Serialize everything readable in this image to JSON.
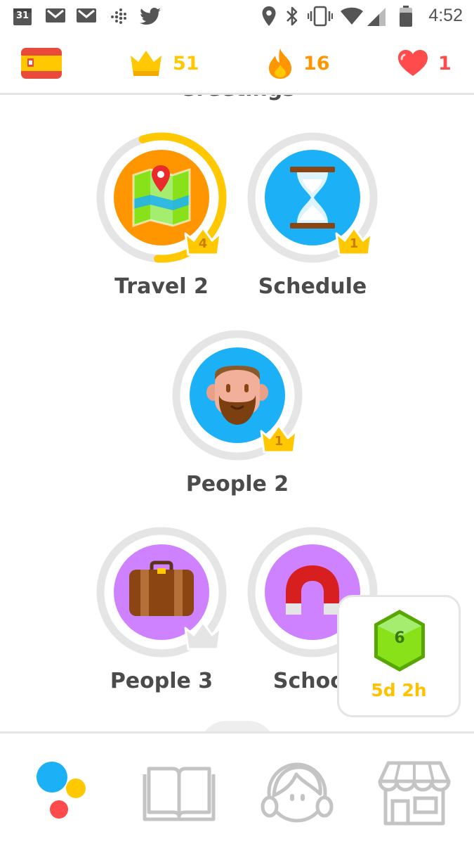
{
  "status_bar": {
    "calendar_day": "31",
    "time": "4:52",
    "icons": [
      "calendar-icon",
      "gmail-icon",
      "gmail-icon",
      "fitbit-icon",
      "twitter-icon",
      "location-icon",
      "bluetooth-icon",
      "vibrate-icon",
      "wifi-icon",
      "signal-icon",
      "battery-icon"
    ]
  },
  "top_bar": {
    "language_flag": "spain-flag-icon",
    "crowns": "51",
    "streak": "16",
    "hearts": "1",
    "colors": {
      "crown": "#ffc800",
      "streak": "#ff9600",
      "heart": "#ff4b4b"
    }
  },
  "section": {
    "title": "Greetings"
  },
  "skills": [
    {
      "label": "Travel 2",
      "level": "4",
      "color": "#ff9600",
      "icon": "map-icon",
      "progress": 0.56
    },
    {
      "label": "Schedule",
      "level": "1",
      "color": "#1cb0f6",
      "icon": "hourglass-icon",
      "progress": 0
    },
    {
      "label": "People 2",
      "level": "1",
      "color": "#1cb0f6",
      "icon": "bearded-man-icon",
      "progress": 0
    },
    {
      "label": "People 3",
      "level": "",
      "color": "#ce82ff",
      "icon": "suitcase-icon",
      "progress": 0
    },
    {
      "label": "School",
      "level": "",
      "color": "#ce82ff",
      "icon": "magnet-icon",
      "progress": 0
    }
  ],
  "league_card": {
    "level": "6",
    "time_left": "5d 2h",
    "color": "#ffc200"
  },
  "bottom_nav": {
    "tabs": [
      "assistant-icon",
      "book-icon",
      "profile-icon",
      "shop-icon"
    ]
  }
}
